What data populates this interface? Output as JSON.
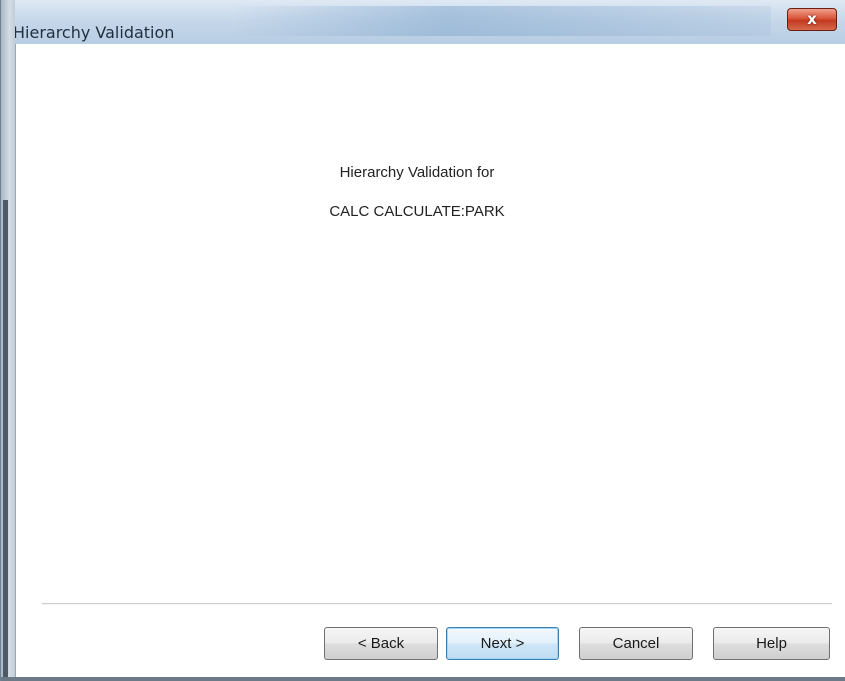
{
  "window": {
    "title": "Hierarchy Validation",
    "close_label": "x"
  },
  "content": {
    "heading_line1": "Hierarchy Validation for",
    "heading_line2": "CALC CALCULATE:PARK"
  },
  "buttons": {
    "back": "< Back",
    "next": "Next >",
    "cancel": "Cancel",
    "help": "Help"
  },
  "icons": {
    "close": "close-icon"
  },
  "colors": {
    "titlebar": "#c6d8ea",
    "close_button": "#d9553a",
    "default_button_border": "#3c7fb1"
  }
}
